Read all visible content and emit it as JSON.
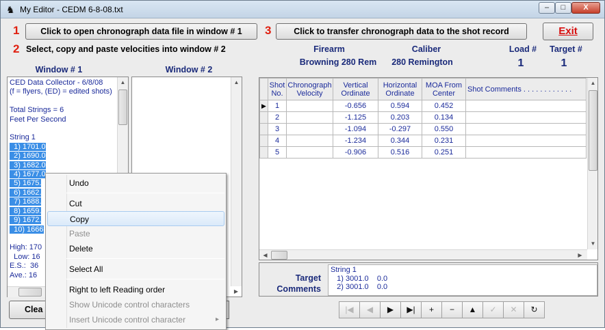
{
  "window": {
    "title": "My Editor - CEDM 6-8-08.txt",
    "min": "–",
    "max": "□",
    "close": "X"
  },
  "steps": {
    "n1": "1",
    "btn1": "Click to open chronograph data file in window # 1",
    "n2": "2",
    "text2": "Select, copy and paste velocities into window  # 2",
    "n3": "3",
    "btn3": "Click to transfer chronograph data to the shot record",
    "exit": "Exit"
  },
  "info": {
    "firearm_label": "Firearm",
    "firearm": "Browning 280 Rem",
    "caliber_label": "Caliber",
    "caliber": "280 Remington",
    "load_label": "Load  #",
    "load": "1",
    "target_label": "Target  #",
    "target": "1"
  },
  "panes": {
    "w1_label": "Window # 1",
    "w2_label": "Window # 2"
  },
  "window1_lines": [
    "CED Data Collector - 6/8/08",
    "(f = flyers, (ED) = edited shots)",
    "",
    "Total Strings = 6",
    "Feet Per Second",
    "",
    "String 1"
  ],
  "window1_selected": [
    "  1) 1701.0",
    "  2) 1690.0",
    "  3) 1682.0",
    "  4) 1677.0",
    "  5) 1675.",
    "  6) 1662.",
    "  7) 1688.",
    "  8) 1659.",
    "  9) 1672.",
    "  10) 1666"
  ],
  "window1_stats": [
    "High: 170",
    "  Low: 16",
    "E.S.:  36",
    "Ave.: 16"
  ],
  "table": {
    "headers": [
      "Shot No.",
      "Chronograph Velocity",
      "Vertical Ordinate",
      "Horizontal Ordinate",
      "MOA From Center",
      "Shot Comments . . . . . . . . . . . ."
    ],
    "rows": [
      [
        "1",
        "",
        "-0.656",
        "0.594",
        "0.452",
        ""
      ],
      [
        "2",
        "",
        "-1.125",
        "0.203",
        "0.134",
        ""
      ],
      [
        "3",
        "",
        "-1.094",
        "-0.297",
        "0.550",
        ""
      ],
      [
        "4",
        "",
        "-1.234",
        "0.344",
        "0.231",
        ""
      ],
      [
        "5",
        "",
        "-0.906",
        "0.516",
        "0.251",
        ""
      ]
    ]
  },
  "target_comments": {
    "label": "Target Comments",
    "text": "String 1\n   1) 3001.0    0.0\n   2) 3001.0    0.0"
  },
  "clear_button": "Clea",
  "context_menu": [
    {
      "label": "Undo",
      "enabled": true
    },
    {
      "sep": true
    },
    {
      "label": "Cut",
      "enabled": true
    },
    {
      "label": "Copy",
      "enabled": true,
      "highlight": true
    },
    {
      "label": "Paste",
      "enabled": false
    },
    {
      "label": "Delete",
      "enabled": true
    },
    {
      "sep": true
    },
    {
      "label": "Select All",
      "enabled": true
    },
    {
      "sep": true
    },
    {
      "label": "Right to left Reading order",
      "enabled": true
    },
    {
      "label": "Show Unicode control characters",
      "enabled": false
    },
    {
      "label": "Insert Unicode control character",
      "enabled": false,
      "submenu": true
    }
  ],
  "navigator": [
    {
      "icon": "first-record-icon",
      "glyph": "|◀",
      "enabled": false
    },
    {
      "icon": "prior-record-icon",
      "glyph": "◀",
      "enabled": false
    },
    {
      "icon": "next-record-icon",
      "glyph": "▶",
      "enabled": true
    },
    {
      "icon": "last-record-icon",
      "glyph": "▶|",
      "enabled": true
    },
    {
      "icon": "add-record-icon",
      "glyph": "+",
      "enabled": true
    },
    {
      "icon": "delete-record-icon",
      "glyph": "−",
      "enabled": true
    },
    {
      "icon": "edit-record-icon",
      "glyph": "▲",
      "enabled": true
    },
    {
      "icon": "post-edit-icon",
      "glyph": "✓",
      "enabled": false
    },
    {
      "icon": "cancel-edit-icon",
      "glyph": "✕",
      "enabled": false
    },
    {
      "icon": "refresh-icon",
      "glyph": "↻",
      "enabled": true
    }
  ]
}
